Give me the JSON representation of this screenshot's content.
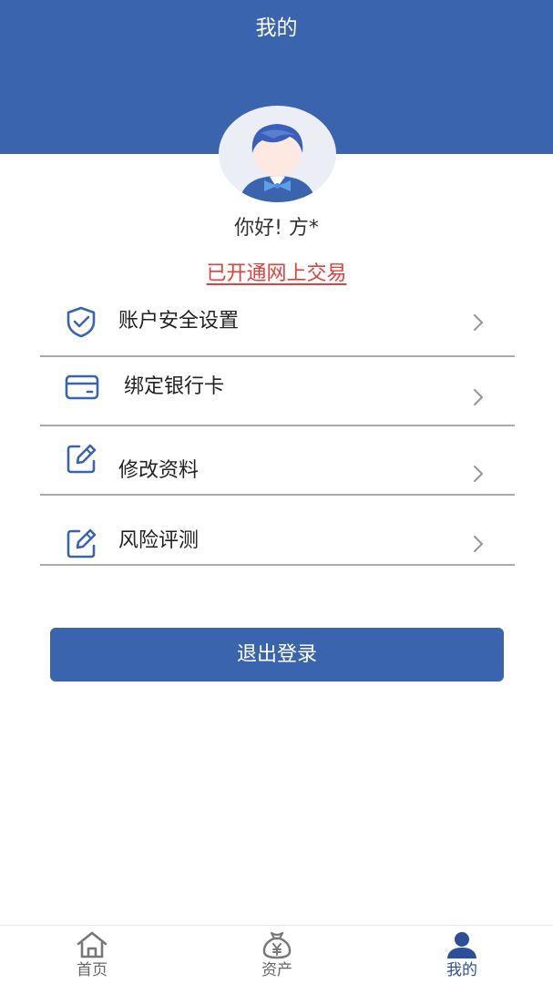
{
  "header": {
    "title": "我的"
  },
  "profile": {
    "greeting": "你好! 方*",
    "trade_status": "已开通网上交易"
  },
  "menu": {
    "items": [
      {
        "label": "账户安全设置",
        "icon": "shield-check-icon"
      },
      {
        "label": "绑定银行卡",
        "icon": "bank-card-icon"
      },
      {
        "label": "修改资料",
        "icon": "edit-icon"
      },
      {
        "label": "风险评测",
        "icon": "edit-icon"
      }
    ]
  },
  "logout": {
    "label": "退出登录"
  },
  "tabbar": {
    "items": [
      {
        "label": "首页",
        "icon": "home-icon",
        "active": false
      },
      {
        "label": "资产",
        "icon": "money-bag-icon",
        "active": false
      },
      {
        "label": "我的",
        "icon": "user-icon",
        "active": true
      }
    ]
  },
  "colors": {
    "primary": "#3a64ad",
    "link_red": "#e0413e",
    "divider": "#aaaaaa",
    "tab_inactive": "#666666",
    "tab_active": "#2d4f99"
  }
}
